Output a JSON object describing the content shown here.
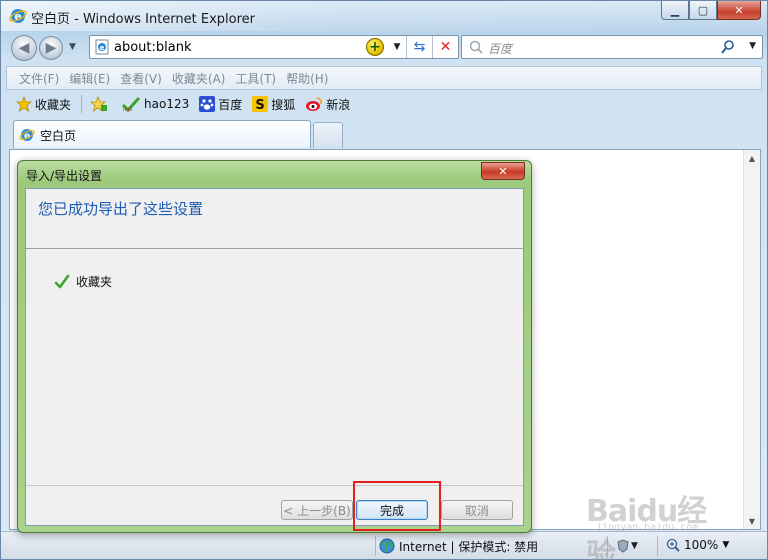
{
  "window": {
    "title": "空白页 - Windows Internet Explorer"
  },
  "address": {
    "value": "about:blank"
  },
  "search": {
    "placeholder": "百度"
  },
  "menu": {
    "items": [
      "文件(F)",
      "编辑(E)",
      "查看(V)",
      "收藏夹(A)",
      "工具(T)",
      "帮助(H)"
    ]
  },
  "favorites": {
    "label": "收藏夹",
    "links": [
      "hao123",
      "百度",
      "搜狐",
      "新浪"
    ]
  },
  "tabs": {
    "active_label": "空白页"
  },
  "dialog": {
    "title": "导入/导出设置",
    "heading": "您已成功导出了这些设置",
    "exported_item": "收藏夹",
    "prev_label": "< 上一步(B)",
    "finish_label": "完成",
    "cancel_label": "取消"
  },
  "status": {
    "zone": "Internet | 保护模式: 禁用",
    "zoom": "100%"
  },
  "watermark": {
    "text": "Baidu经验",
    "sub": "jingyan.baidu.com"
  },
  "colors": {
    "accent_heading": "#1e5cb3",
    "highlight_box": "#e0201c",
    "dialog_frame": "#9cc97c"
  }
}
